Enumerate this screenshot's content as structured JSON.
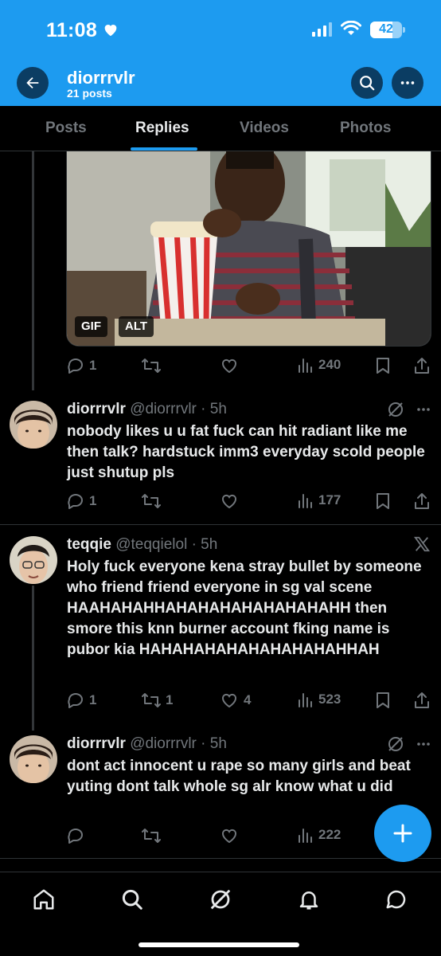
{
  "status_bar": {
    "time": "11:08",
    "battery": "42"
  },
  "header": {
    "title": "diorrrvlr",
    "subtitle": "21 posts"
  },
  "tabs": [
    {
      "label": "Posts",
      "active": false
    },
    {
      "label": "Replies",
      "active": true
    },
    {
      "label": "Videos",
      "active": false
    },
    {
      "label": "Photos",
      "active": false
    }
  ],
  "media": {
    "badges": [
      "GIF",
      "ALT"
    ]
  },
  "posts": [
    {
      "stats": {
        "replies": "1",
        "reposts": "",
        "likes": "",
        "views": "240"
      }
    },
    {
      "name": "diorrrvlr",
      "handle": "@diorrrvlr · 5h",
      "text": "nobody likes u u fat fuck can hit radiant like me then talk? hardstuck imm3 everyday scold people just shutup pls",
      "stats": {
        "replies": "1",
        "reposts": "",
        "likes": "",
        "views": "177"
      }
    },
    {
      "name": "teqqie",
      "handle": "@teqqielol · 5h",
      "text": "Holy fuck everyone kena stray bullet by someone who friend friend everyone in sg val scene HAAHAHAHHAHAHAHAHAHAHAHAHH then smore this knn burner account fking name is pubor kia HAHAHAHAHAHAHAHAHAHHAH",
      "stats": {
        "replies": "1",
        "reposts": "1",
        "likes": "4",
        "views": "523"
      }
    },
    {
      "name": "diorrrvlr",
      "handle": "@diorrrvlr · 5h",
      "text": "dont act innocent u rape so many girls and beat yuting dont talk whole sg alr know what u did",
      "stats": {
        "replies": "",
        "reposts": "",
        "likes": "",
        "views": "222"
      }
    }
  ],
  "colors": {
    "accent": "#1d9bf0",
    "muted": "#71767b",
    "background": "#000000"
  }
}
